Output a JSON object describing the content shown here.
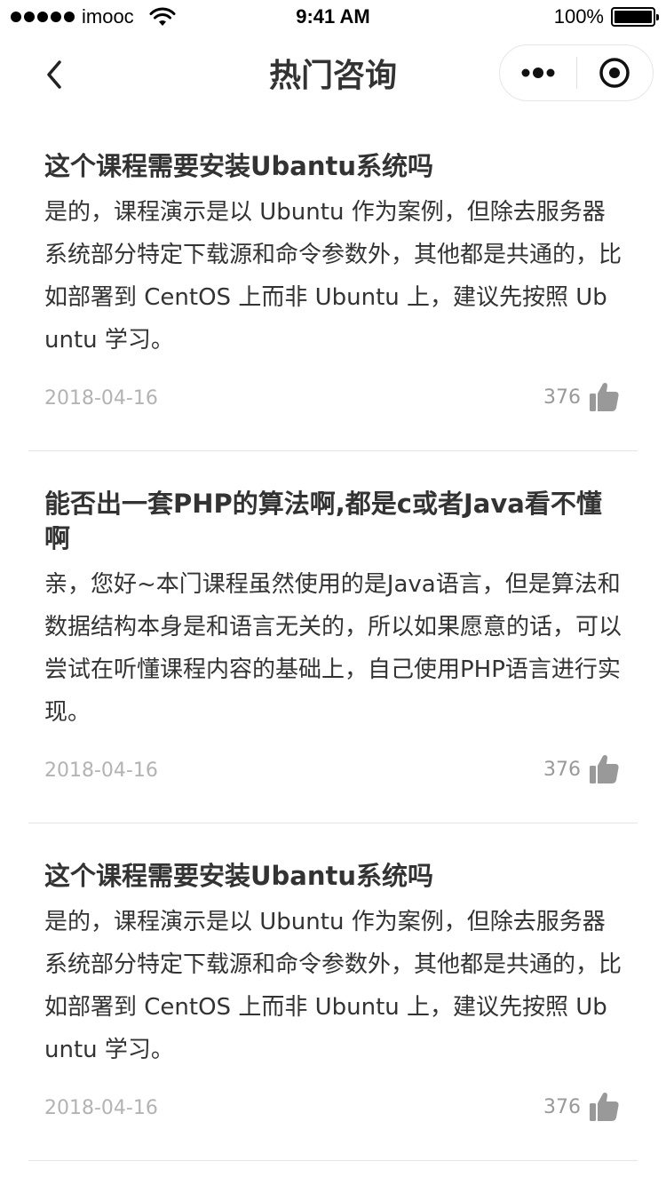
{
  "status_bar": {
    "carrier": "imooc",
    "time": "9:41 AM",
    "battery": "100%"
  },
  "nav": {
    "title": "热门咨询",
    "back_icon": "chevron-left-icon",
    "more_icon": "more-dots-icon",
    "close_icon": "target-circle-icon"
  },
  "colors": {
    "text": "#333333",
    "meta": "#b3b3b3",
    "like": "#999999",
    "divider": "#e5e5e5"
  },
  "items": [
    {
      "title": "这个课程需要安装Ubantu系统吗",
      "content": "是的，课程演示是以 Ubuntu 作为案例，但除去服务器系统部分特定下载源和命令参数外，其他都是共通的，比如部署到 CentOS 上而非 Ubuntu 上，建议先按照 Ubuntu 学习。",
      "date": "2018-04-16",
      "likes": "376"
    },
    {
      "title": "能否出一套PHP的算法啊,都是c或者Java看不懂啊",
      "content": "亲，您好~本门课程虽然使用的是Java语言，但是算法和数据结构本身是和语言无关的，所以如果愿意的话，可以尝试在听懂课程内容的基础上，自己使用PHP语言进行实现。",
      "date": "2018-04-16",
      "likes": "376"
    },
    {
      "title": "这个课程需要安装Ubantu系统吗",
      "content": "是的，课程演示是以 Ubuntu 作为案例，但除去服务器系统部分特定下载源和命令参数外，其他都是共通的，比如部署到 CentOS 上而非 Ubuntu 上，建议先按照 Ubuntu 学习。",
      "date": "2018-04-16",
      "likes": "376"
    }
  ]
}
